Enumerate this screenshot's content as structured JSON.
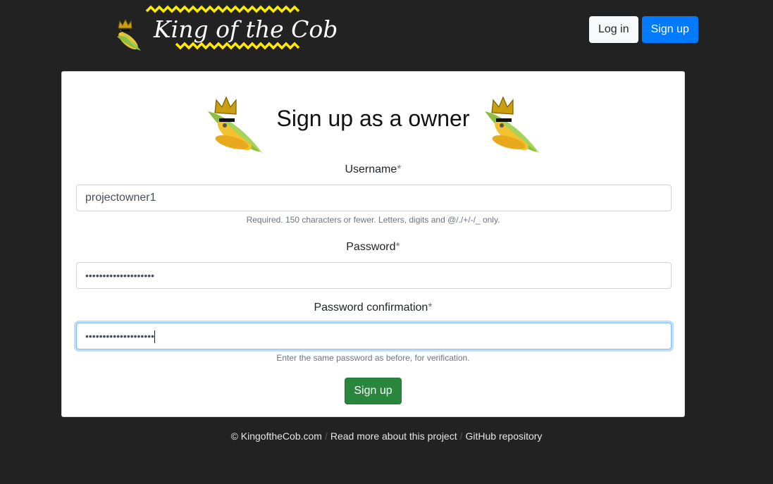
{
  "brand": {
    "logo_text": "King of the Cob"
  },
  "nav": {
    "login_label": "Log in",
    "signup_label": "Sign up"
  },
  "form": {
    "title": "Sign up as a owner",
    "required_marker": "*",
    "username": {
      "label": "Username",
      "value": "projectowner1",
      "help": "Required. 150 characters or fewer. Letters, digits and @/./+/-/_ only."
    },
    "password": {
      "label": "Password",
      "value_masked": "••••••••••••••••••••"
    },
    "password_confirmation": {
      "label": "Password confirmation",
      "value_masked": "••••••••••••••••••••",
      "help": "Enter the same password as before, for verification."
    },
    "submit_label": "Sign up"
  },
  "footer": {
    "copyright": "© KingoftheCob.com",
    "about_link": "Read more about this project",
    "github_link": "GitHub repository",
    "separator": "/"
  },
  "colors": {
    "page_bg": "#222222",
    "primary": "#007bff",
    "success": "#28873c",
    "logo_zigzag": "#ffeb00"
  },
  "icons": [
    "crowned-corn-logo-icon",
    "crowned-corn-icon"
  ]
}
